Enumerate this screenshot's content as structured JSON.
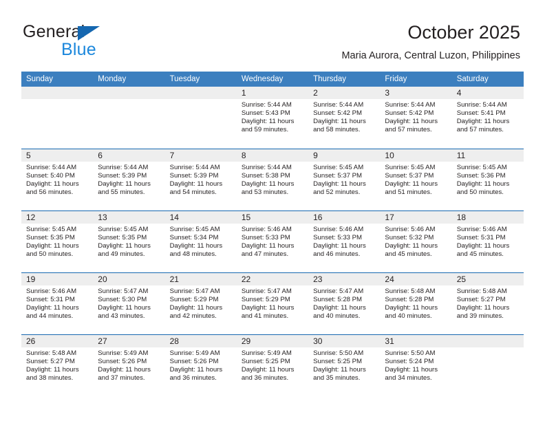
{
  "brand": {
    "name_part1": "General",
    "name_part2": "Blue",
    "flag_icon": "triangle-flag-icon"
  },
  "header": {
    "month_title": "October 2025",
    "location": "Maria Aurora, Central Luzon, Philippines"
  },
  "colors": {
    "header_blue": "#3c7fbf",
    "rule_blue": "#1567b0",
    "brand_blue": "#1b87dc",
    "day_band_gray": "#eeeeee",
    "text": "#231f20"
  },
  "weekdays": [
    "Sunday",
    "Monday",
    "Tuesday",
    "Wednesday",
    "Thursday",
    "Friday",
    "Saturday"
  ],
  "weeks": [
    [
      {
        "day": "",
        "empty": true
      },
      {
        "day": "",
        "empty": true
      },
      {
        "day": "",
        "empty": true
      },
      {
        "day": "1",
        "sunrise": "Sunrise: 5:44 AM",
        "sunset": "Sunset: 5:43 PM",
        "daylight": "Daylight: 11 hours and 59 minutes."
      },
      {
        "day": "2",
        "sunrise": "Sunrise: 5:44 AM",
        "sunset": "Sunset: 5:42 PM",
        "daylight": "Daylight: 11 hours and 58 minutes."
      },
      {
        "day": "3",
        "sunrise": "Sunrise: 5:44 AM",
        "sunset": "Sunset: 5:42 PM",
        "daylight": "Daylight: 11 hours and 57 minutes."
      },
      {
        "day": "4",
        "sunrise": "Sunrise: 5:44 AM",
        "sunset": "Sunset: 5:41 PM",
        "daylight": "Daylight: 11 hours and 57 minutes."
      }
    ],
    [
      {
        "day": "5",
        "sunrise": "Sunrise: 5:44 AM",
        "sunset": "Sunset: 5:40 PM",
        "daylight": "Daylight: 11 hours and 56 minutes."
      },
      {
        "day": "6",
        "sunrise": "Sunrise: 5:44 AM",
        "sunset": "Sunset: 5:39 PM",
        "daylight": "Daylight: 11 hours and 55 minutes."
      },
      {
        "day": "7",
        "sunrise": "Sunrise: 5:44 AM",
        "sunset": "Sunset: 5:39 PM",
        "daylight": "Daylight: 11 hours and 54 minutes."
      },
      {
        "day": "8",
        "sunrise": "Sunrise: 5:44 AM",
        "sunset": "Sunset: 5:38 PM",
        "daylight": "Daylight: 11 hours and 53 minutes."
      },
      {
        "day": "9",
        "sunrise": "Sunrise: 5:45 AM",
        "sunset": "Sunset: 5:37 PM",
        "daylight": "Daylight: 11 hours and 52 minutes."
      },
      {
        "day": "10",
        "sunrise": "Sunrise: 5:45 AM",
        "sunset": "Sunset: 5:37 PM",
        "daylight": "Daylight: 11 hours and 51 minutes."
      },
      {
        "day": "11",
        "sunrise": "Sunrise: 5:45 AM",
        "sunset": "Sunset: 5:36 PM",
        "daylight": "Daylight: 11 hours and 50 minutes."
      }
    ],
    [
      {
        "day": "12",
        "sunrise": "Sunrise: 5:45 AM",
        "sunset": "Sunset: 5:35 PM",
        "daylight": "Daylight: 11 hours and 50 minutes."
      },
      {
        "day": "13",
        "sunrise": "Sunrise: 5:45 AM",
        "sunset": "Sunset: 5:35 PM",
        "daylight": "Daylight: 11 hours and 49 minutes."
      },
      {
        "day": "14",
        "sunrise": "Sunrise: 5:45 AM",
        "sunset": "Sunset: 5:34 PM",
        "daylight": "Daylight: 11 hours and 48 minutes."
      },
      {
        "day": "15",
        "sunrise": "Sunrise: 5:46 AM",
        "sunset": "Sunset: 5:33 PM",
        "daylight": "Daylight: 11 hours and 47 minutes."
      },
      {
        "day": "16",
        "sunrise": "Sunrise: 5:46 AM",
        "sunset": "Sunset: 5:33 PM",
        "daylight": "Daylight: 11 hours and 46 minutes."
      },
      {
        "day": "17",
        "sunrise": "Sunrise: 5:46 AM",
        "sunset": "Sunset: 5:32 PM",
        "daylight": "Daylight: 11 hours and 45 minutes."
      },
      {
        "day": "18",
        "sunrise": "Sunrise: 5:46 AM",
        "sunset": "Sunset: 5:31 PM",
        "daylight": "Daylight: 11 hours and 45 minutes."
      }
    ],
    [
      {
        "day": "19",
        "sunrise": "Sunrise: 5:46 AM",
        "sunset": "Sunset: 5:31 PM",
        "daylight": "Daylight: 11 hours and 44 minutes."
      },
      {
        "day": "20",
        "sunrise": "Sunrise: 5:47 AM",
        "sunset": "Sunset: 5:30 PM",
        "daylight": "Daylight: 11 hours and 43 minutes."
      },
      {
        "day": "21",
        "sunrise": "Sunrise: 5:47 AM",
        "sunset": "Sunset: 5:29 PM",
        "daylight": "Daylight: 11 hours and 42 minutes."
      },
      {
        "day": "22",
        "sunrise": "Sunrise: 5:47 AM",
        "sunset": "Sunset: 5:29 PM",
        "daylight": "Daylight: 11 hours and 41 minutes."
      },
      {
        "day": "23",
        "sunrise": "Sunrise: 5:47 AM",
        "sunset": "Sunset: 5:28 PM",
        "daylight": "Daylight: 11 hours and 40 minutes."
      },
      {
        "day": "24",
        "sunrise": "Sunrise: 5:48 AM",
        "sunset": "Sunset: 5:28 PM",
        "daylight": "Daylight: 11 hours and 40 minutes."
      },
      {
        "day": "25",
        "sunrise": "Sunrise: 5:48 AM",
        "sunset": "Sunset: 5:27 PM",
        "daylight": "Daylight: 11 hours and 39 minutes."
      }
    ],
    [
      {
        "day": "26",
        "sunrise": "Sunrise: 5:48 AM",
        "sunset": "Sunset: 5:27 PM",
        "daylight": "Daylight: 11 hours and 38 minutes."
      },
      {
        "day": "27",
        "sunrise": "Sunrise: 5:49 AM",
        "sunset": "Sunset: 5:26 PM",
        "daylight": "Daylight: 11 hours and 37 minutes."
      },
      {
        "day": "28",
        "sunrise": "Sunrise: 5:49 AM",
        "sunset": "Sunset: 5:26 PM",
        "daylight": "Daylight: 11 hours and 36 minutes."
      },
      {
        "day": "29",
        "sunrise": "Sunrise: 5:49 AM",
        "sunset": "Sunset: 5:25 PM",
        "daylight": "Daylight: 11 hours and 36 minutes."
      },
      {
        "day": "30",
        "sunrise": "Sunrise: 5:50 AM",
        "sunset": "Sunset: 5:25 PM",
        "daylight": "Daylight: 11 hours and 35 minutes."
      },
      {
        "day": "31",
        "sunrise": "Sunrise: 5:50 AM",
        "sunset": "Sunset: 5:24 PM",
        "daylight": "Daylight: 11 hours and 34 minutes."
      },
      {
        "day": "",
        "empty": true
      }
    ]
  ]
}
